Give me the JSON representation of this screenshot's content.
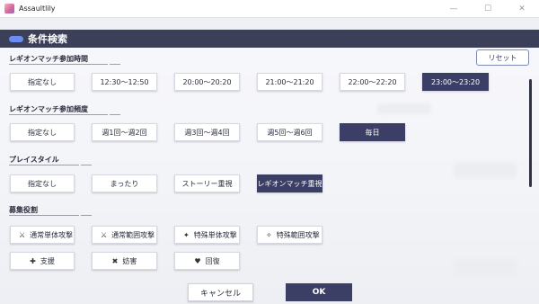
{
  "window": {
    "title": "Assaultlily",
    "controls": {
      "minimize": "—",
      "maximize": "☐",
      "close": "✕"
    }
  },
  "modal": {
    "title": "条件検索",
    "reset_label": "リセット",
    "cancel_label": "キャンセル",
    "ok_label": "OK"
  },
  "sections": {
    "time": {
      "title": "レギオンマッチ参加時間",
      "options": [
        "指定なし",
        "12:30〜12:50",
        "20:00〜20:20",
        "21:00〜21:20",
        "22:00〜22:20",
        "23:00〜23:20"
      ],
      "selected": "23:00〜23:20"
    },
    "frequency": {
      "title": "レギオンマッチ参加頻度",
      "options": [
        "指定なし",
        "週1回〜週2回",
        "週3回〜週4回",
        "週5回〜週6回",
        "毎日"
      ],
      "selected": "毎日"
    },
    "style": {
      "title": "プレイスタイル",
      "options": [
        "指定なし",
        "まったり",
        "ストーリー重視",
        "レギオンマッチ重視"
      ],
      "selected": "レギオンマッチ重視"
    },
    "roles": {
      "title": "募集役割",
      "options": [
        {
          "label": "通常単体攻撃",
          "icon": "single-attack-icon"
        },
        {
          "label": "通常範囲攻撃",
          "icon": "area-attack-icon"
        },
        {
          "label": "特殊単体攻撃",
          "icon": "special-single-attack-icon"
        },
        {
          "label": "特殊範囲攻撃",
          "icon": "special-area-attack-icon"
        },
        {
          "label": "支援",
          "icon": "support-icon"
        },
        {
          "label": "妨害",
          "icon": "interference-icon"
        },
        {
          "label": "回復",
          "icon": "heal-icon"
        }
      ]
    }
  },
  "colors": {
    "header_bg": "#3b3f57",
    "selected_bg": "#3b3f66",
    "accent_pill": "#6b8cf0"
  }
}
